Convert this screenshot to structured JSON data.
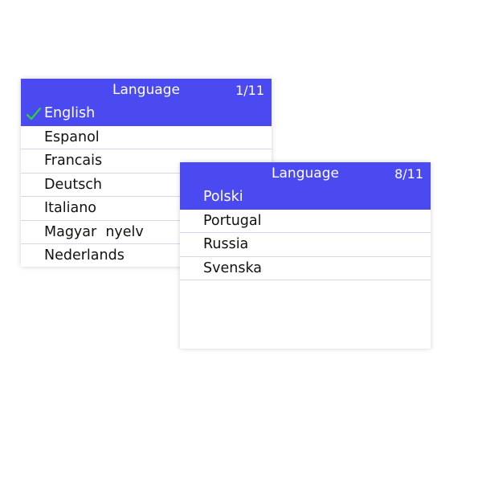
{
  "screen1": {
    "title": "Language",
    "page": "1/11",
    "items": [
      {
        "label": "English",
        "selected": true,
        "checked": true
      },
      {
        "label": "Espanol"
      },
      {
        "label": "Francais"
      },
      {
        "label": "Deutsch"
      },
      {
        "label": "Italiano"
      },
      {
        "label": "Magyar  nyelv"
      },
      {
        "label": "Nederlands"
      }
    ]
  },
  "screen2": {
    "title": "Language",
    "page": "8/11",
    "items": [
      {
        "label": "Polski",
        "selected": true
      },
      {
        "label": "Portugal"
      },
      {
        "label": "Russia"
      },
      {
        "label": "Svenska"
      }
    ]
  },
  "colors": {
    "header_bg": "#4a4af0",
    "selected_bg": "#4a4af0",
    "check": "#2ecc40",
    "divider": "#d6d6ee"
  },
  "icons": {
    "checked_item": "checkmark-icon"
  }
}
